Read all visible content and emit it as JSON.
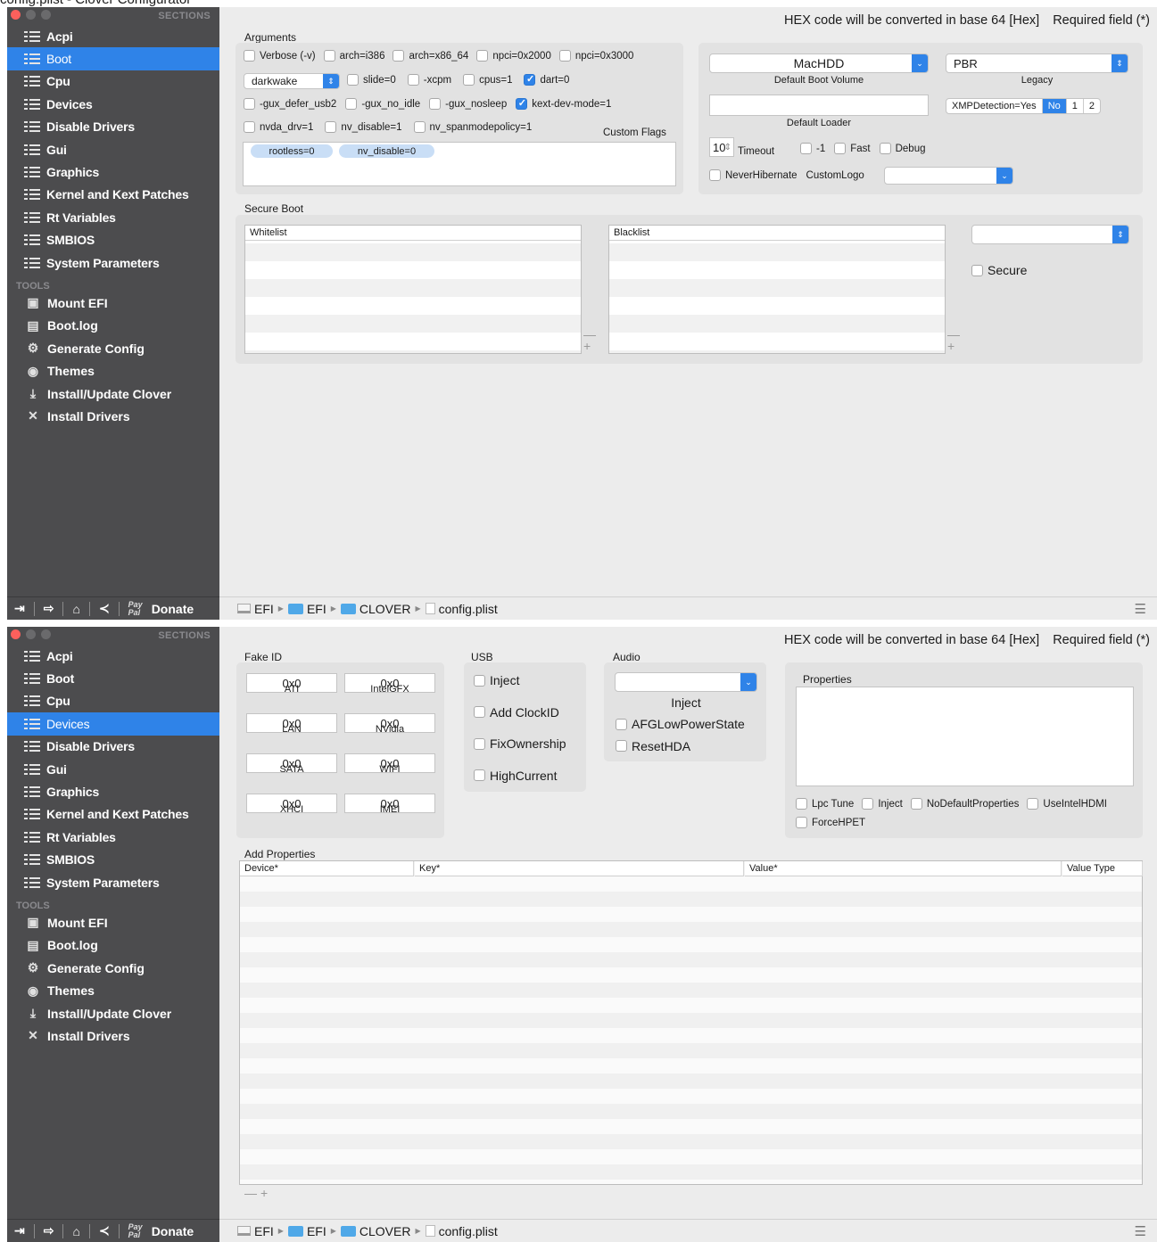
{
  "window_title_partial": "config.plist - Clover Configurator",
  "colors": {
    "sidebar": "#4c4c4e",
    "accent": "#2f83e8",
    "close": "#fc605c",
    "minimize": "#5a5a5c",
    "zoom": "#5a5a5c"
  },
  "sidebar": {
    "sections_header": "SECTIONS",
    "sections": [
      "Acpi",
      "Boot",
      "Cpu",
      "Devices",
      "Disable Drivers",
      "Gui",
      "Graphics",
      "Kernel and Kext Patches",
      "Rt Variables",
      "SMBIOS",
      "System Parameters"
    ],
    "tools_header": "TOOLS",
    "tools": [
      "Mount EFI",
      "Boot.log",
      "Generate Config",
      "Themes",
      "Install/Update Clover",
      "Install Drivers"
    ],
    "donate": "Donate",
    "paypal_top": "Pay",
    "paypal_bottom": "Pal"
  },
  "header": {
    "hex_note": "HEX code will be converted in base 64 [Hex]",
    "required": "Required field (*)"
  },
  "path": {
    "drive": "EFI",
    "folder1": "EFI",
    "folder2": "CLOVER",
    "file": "config.plist"
  },
  "boot": {
    "arguments_label": "Arguments",
    "row1": [
      {
        "label": "Verbose (-v)",
        "checked": false
      },
      {
        "label": "arch=i386",
        "checked": false
      },
      {
        "label": "arch=x86_64",
        "checked": false
      },
      {
        "label": "npci=0x2000",
        "checked": false
      },
      {
        "label": "npci=0x3000",
        "checked": false
      }
    ],
    "darkwake_value": "darkwake",
    "row2": [
      {
        "label": "slide=0",
        "checked": false
      },
      {
        "label": "-xcpm",
        "checked": false
      },
      {
        "label": "cpus=1",
        "checked": false
      },
      {
        "label": "dart=0",
        "checked": true
      }
    ],
    "row3": [
      {
        "label": "-gux_defer_usb2",
        "checked": false
      },
      {
        "label": "-gux_no_idle",
        "checked": false
      },
      {
        "label": "-gux_nosleep",
        "checked": false
      },
      {
        "label": "kext-dev-mode=1",
        "checked": true
      }
    ],
    "row4": [
      {
        "label": "nvda_drv=1",
        "checked": false
      },
      {
        "label": "nv_disable=1",
        "checked": false
      },
      {
        "label": "nv_spanmodepolicy=1",
        "checked": false
      }
    ],
    "custom_flags_label": "Custom Flags",
    "custom_flags": [
      "rootless=0",
      "nv_disable=0"
    ],
    "default_boot_volume": "MacHDD",
    "default_boot_volume_label": "Default Boot Volume",
    "legacy_value": "PBR",
    "legacy_label": "Legacy",
    "default_loader_label": "Default Loader",
    "xmp_label": "XMPDetection=Yes",
    "xmp_options": [
      "No",
      "1",
      "2"
    ],
    "xmp_selected": "No",
    "timeout_value": "10",
    "timeout_label": "Timeout",
    "timeout_flags": [
      {
        "label": "-1",
        "checked": false
      },
      {
        "label": "Fast",
        "checked": false
      },
      {
        "label": "Debug",
        "checked": false
      }
    ],
    "never_hibernate": "NeverHibernate",
    "custom_logo": "CustomLogo",
    "secure_boot_label": "Secure Boot",
    "whitelist": "Whitelist",
    "blacklist": "Blacklist",
    "secure": "Secure",
    "plus": "+",
    "minus": "—"
  },
  "devices": {
    "fake_id_label": "Fake ID",
    "fake_ids": [
      {
        "value": "0x0",
        "label": "ATI"
      },
      {
        "value": "0x0",
        "label": "IntelGFX"
      },
      {
        "value": "0x0",
        "label": "LAN"
      },
      {
        "value": "0x0",
        "label": "NVidia"
      },
      {
        "value": "0x0",
        "label": "SATA"
      },
      {
        "value": "0x0",
        "label": "WIFI"
      },
      {
        "value": "0x0",
        "label": "XHCI"
      },
      {
        "value": "0x0",
        "label": "IMEI"
      }
    ],
    "usb_label": "USB",
    "usb": [
      "Inject",
      "Add ClockID",
      "FixOwnership",
      "HighCurrent"
    ],
    "audio_label": "Audio",
    "audio_inject": "Inject",
    "audio_checks": [
      "AFGLowPowerState",
      "ResetHDA"
    ],
    "properties_label": "Properties",
    "prop_checks": [
      "Lpc Tune",
      "Inject",
      "NoDefaultProperties",
      "UseIntelHDMI",
      "ForceHPET"
    ],
    "add_properties_label": "Add Properties",
    "columns": [
      "Device*",
      "Key*",
      "Value*",
      "Value Type"
    ]
  }
}
